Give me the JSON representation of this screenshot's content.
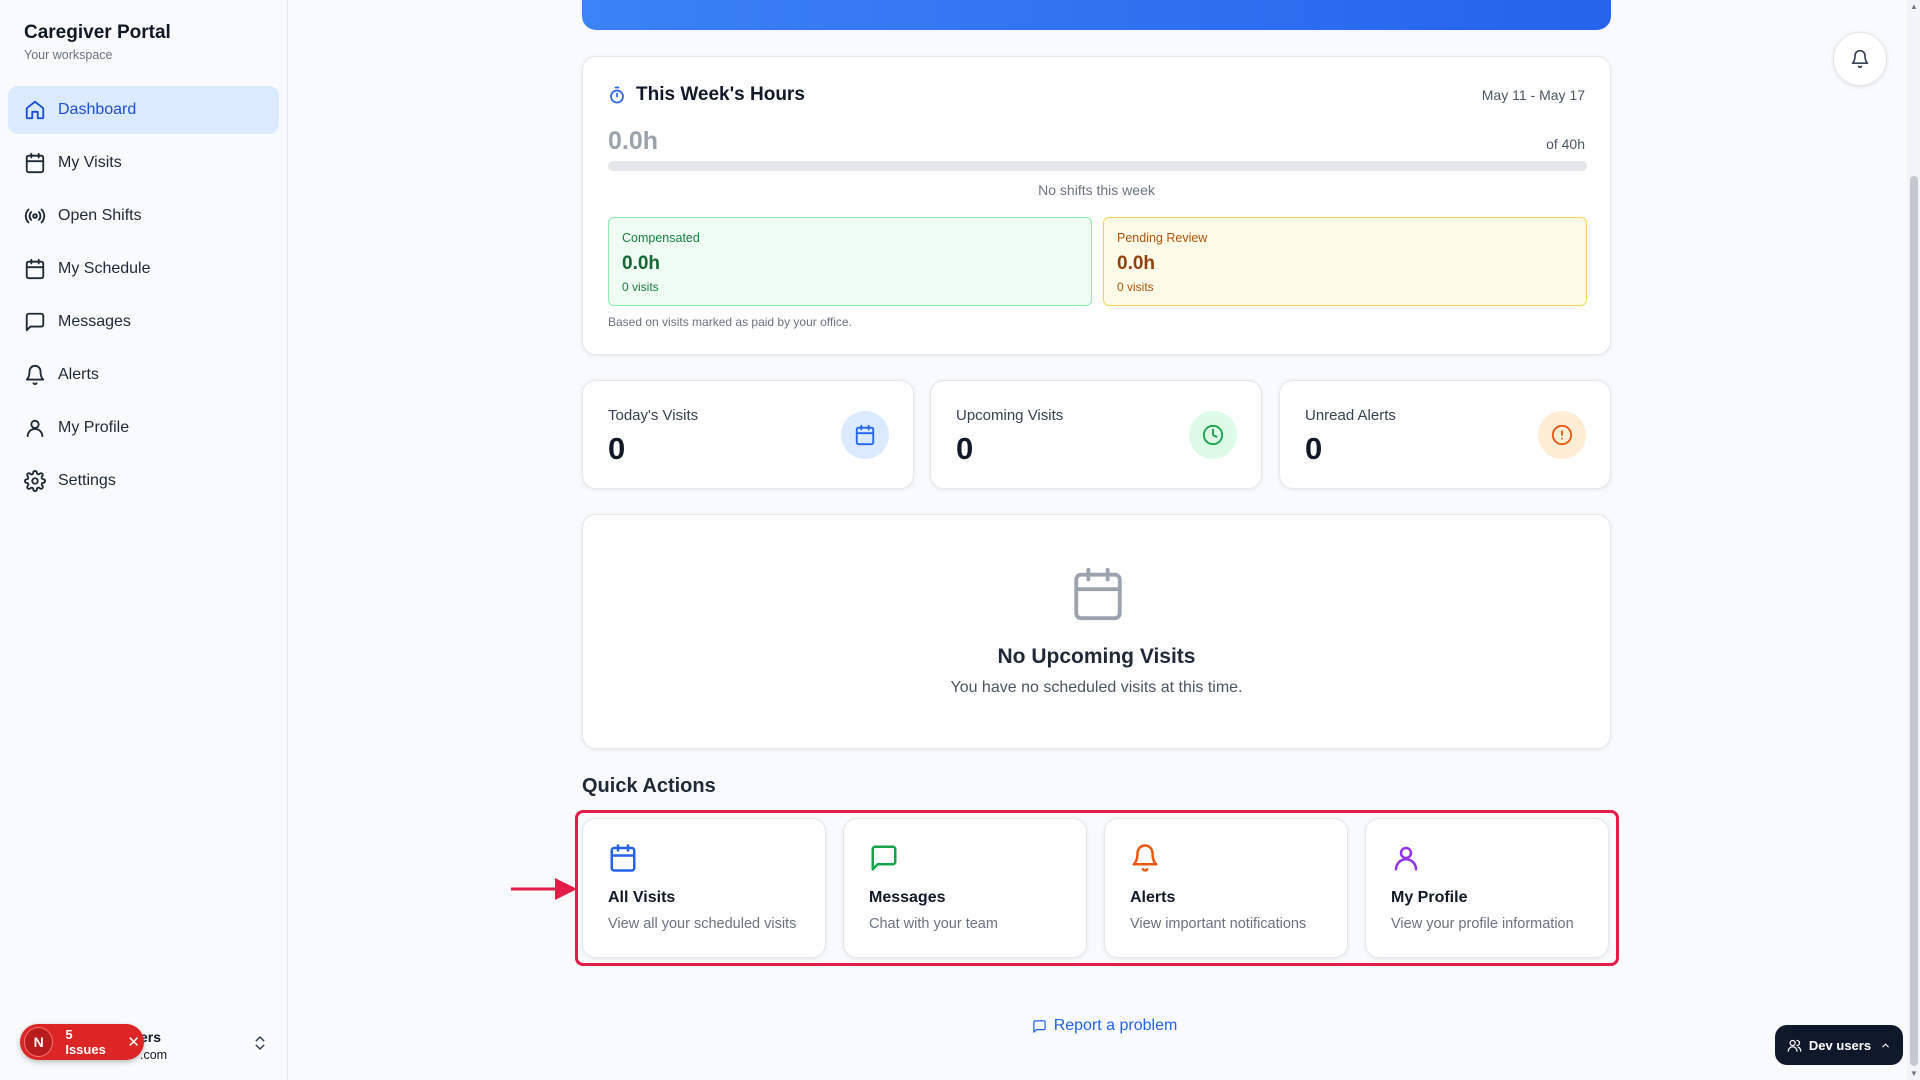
{
  "brand": {
    "title": "Caregiver Portal",
    "subtitle": "Your workspace"
  },
  "nav": [
    {
      "label": "Dashboard",
      "icon": "home-icon",
      "active": true
    },
    {
      "label": "My Visits",
      "icon": "calendar-icon"
    },
    {
      "label": "Open Shifts",
      "icon": "broadcast-icon"
    },
    {
      "label": "My Schedule",
      "icon": "calendar-icon"
    },
    {
      "label": "Messages",
      "icon": "message-icon"
    },
    {
      "label": "Alerts",
      "icon": "bell-icon"
    },
    {
      "label": "My Profile",
      "icon": "user-icon"
    },
    {
      "label": "Settings",
      "icon": "gear-icon"
    }
  ],
  "user": {
    "name_fragment": "ers",
    "email_fragment": ".com"
  },
  "issues": {
    "initial": "N",
    "label": "5 Issues"
  },
  "hours": {
    "title": "This Week's Hours",
    "range": "May 11 - May 17",
    "value": "0.0h",
    "of": "of 40h",
    "progress_fraction": 0,
    "empty_text": "No shifts this week",
    "compensated": {
      "label": "Compensated",
      "value": "0.0h",
      "sub": "0 visits"
    },
    "pending": {
      "label": "Pending Review",
      "value": "0.0h",
      "sub": "0 visits"
    },
    "note": "Based on visits marked as paid by your office."
  },
  "metrics": [
    {
      "label": "Today's Visits",
      "value": "0",
      "icon": "calendar-icon",
      "color": "#2563eb",
      "bg": "#dbeafe"
    },
    {
      "label": "Upcoming Visits",
      "value": "0",
      "icon": "clock-icon",
      "color": "#16a34a",
      "bg": "#dcfce7"
    },
    {
      "label": "Unread Alerts",
      "value": "0",
      "icon": "alert-circle-icon",
      "color": "#ea580c",
      "bg": "#ffedd5"
    }
  ],
  "empty": {
    "title": "No Upcoming Visits",
    "subtitle": "You have no scheduled visits at this time."
  },
  "quick_actions": {
    "title": "Quick Actions",
    "items": [
      {
        "name": "All Visits",
        "desc": "View all your scheduled visits",
        "icon": "calendar-icon",
        "color": "#2563eb"
      },
      {
        "name": "Messages",
        "desc": "Chat with your team",
        "icon": "message-icon",
        "color": "#16a34a"
      },
      {
        "name": "Alerts",
        "desc": "View important notifications",
        "icon": "bell-icon",
        "color": "#ea580c"
      },
      {
        "name": "My Profile",
        "desc": "View your profile information",
        "icon": "user-icon",
        "color": "#9333ea"
      }
    ]
  },
  "report": {
    "label": "Report a problem"
  },
  "dev": {
    "label": "Dev users"
  },
  "colors": {
    "primary": "#2563eb",
    "highlight": "#e11d48"
  }
}
